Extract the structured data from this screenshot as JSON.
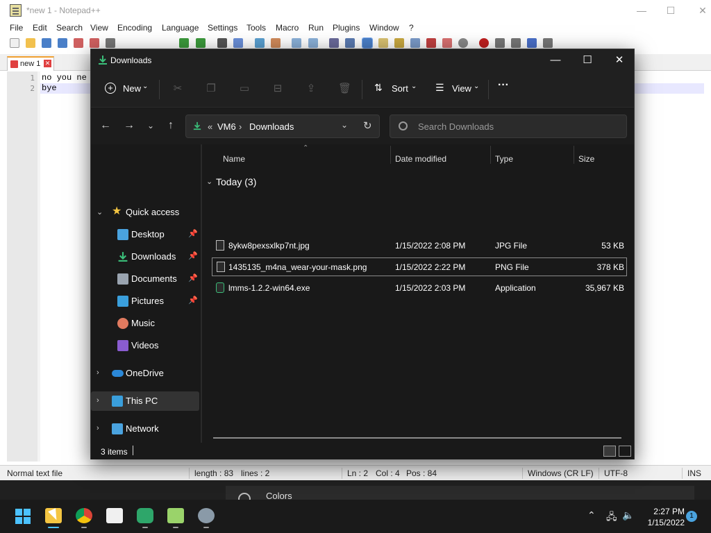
{
  "notepad": {
    "title": "*new 1 - Notepad++",
    "menu": [
      "File",
      "Edit",
      "Search",
      "View",
      "Encoding",
      "Language",
      "Settings",
      "Tools",
      "Macro",
      "Run",
      "Plugins",
      "Window",
      "?"
    ],
    "tab_label": "new 1",
    "line_numbers": [
      "1",
      "2"
    ],
    "lines": [
      "no you ne",
      "bye"
    ],
    "status": {
      "file_type": "Normal text file",
      "length": "length : 83",
      "lines": "lines : 2",
      "ln": "Ln : 2",
      "col": "Col : 4",
      "pos": "Pos : 84",
      "eol": "Windows (CR LF)",
      "encoding": "UTF-8",
      "mode": "INS"
    }
  },
  "background_panel": {
    "label": "Colors"
  },
  "explorer": {
    "title": "Downloads",
    "commands": {
      "new": "New",
      "sort": "Sort",
      "view": "View",
      "more": "···"
    },
    "address": {
      "overflow": "«",
      "segment1": "VM6",
      "separator": "›",
      "segment2": "Downloads"
    },
    "search_placeholder": "Search Downloads",
    "sidebar": {
      "quick_access": "Quick access",
      "items": [
        {
          "label": "Desktop",
          "icon": "desktop-icon",
          "color": "#4aa3df",
          "pinned": true
        },
        {
          "label": "Downloads",
          "icon": "download-icon",
          "color": "#3bbf7a",
          "pinned": true
        },
        {
          "label": "Documents",
          "icon": "documents-icon",
          "color": "#9aa4b0",
          "pinned": true
        },
        {
          "label": "Pictures",
          "icon": "pictures-icon",
          "color": "#3a9fdc",
          "pinned": true
        },
        {
          "label": "Music",
          "icon": "music-icon",
          "color": "#e07a5f",
          "pinned": false
        },
        {
          "label": "Videos",
          "icon": "videos-icon",
          "color": "#8a5cd0",
          "pinned": false
        }
      ],
      "onedrive": "OneDrive",
      "this_pc": "This PC",
      "network": "Network"
    },
    "columns": {
      "name": "Name",
      "date": "Date modified",
      "type": "Type",
      "size": "Size"
    },
    "group": "Today (3)",
    "files": [
      {
        "name": "8ykw8pexsxlkp7nt.jpg",
        "date": "1/15/2022 2:08 PM",
        "type": "JPG File",
        "size": "53 KB",
        "selected": false
      },
      {
        "name": "1435135_m4na_wear-your-mask.png",
        "date": "1/15/2022 2:22 PM",
        "type": "PNG File",
        "size": "378 KB",
        "selected": true
      },
      {
        "name": "lmms-1.2.2-win64.exe",
        "date": "1/15/2022 2:03 PM",
        "type": "Application",
        "size": "35,967 KB",
        "selected": false
      }
    ],
    "status_items": "3 items"
  },
  "taskbar": {
    "apps": [
      "start-icon",
      "file-explorer-icon",
      "chrome-icon",
      "store-icon",
      "lmms-icon",
      "notepadpp-icon",
      "settings-icon"
    ],
    "time": "2:27 PM",
    "date": "1/15/2022",
    "notifications": "1"
  },
  "colors": {
    "accent": "#4cc2ff",
    "download_green": "#3bbf7a",
    "folder_yellow": "#f4c542"
  }
}
